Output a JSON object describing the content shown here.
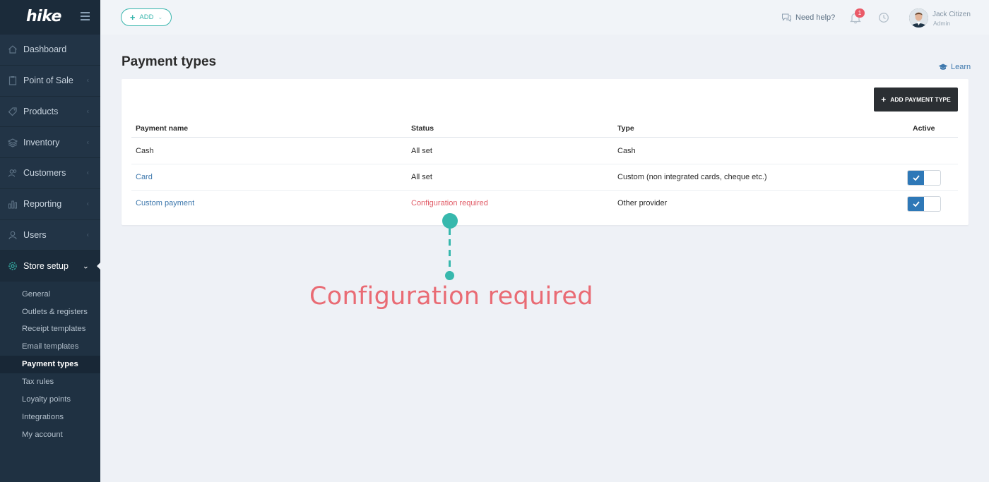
{
  "app": {
    "logo_text": "hike",
    "add_button_label": "ADD"
  },
  "header": {
    "help_label": "Need help?",
    "notification_count": "1",
    "user_name": "Jack Citizen",
    "user_role": "Admin"
  },
  "sidebar": {
    "items": [
      {
        "label": "Dashboard",
        "icon": "home-icon"
      },
      {
        "label": "Point of Sale",
        "icon": "clipboard-icon"
      },
      {
        "label": "Products",
        "icon": "tag-icon"
      },
      {
        "label": "Inventory",
        "icon": "layers-icon"
      },
      {
        "label": "Customers",
        "icon": "users-icon"
      },
      {
        "label": "Reporting",
        "icon": "bar-chart-icon"
      },
      {
        "label": "Users",
        "icon": "user-icon"
      },
      {
        "label": "Store setup",
        "icon": "gear-icon"
      }
    ],
    "sub_items": [
      "General",
      "Outlets & registers",
      "Receipt templates",
      "Email templates",
      "Payment types",
      "Tax rules",
      "Loyalty points",
      "Integrations",
      "My account"
    ],
    "active_sub_item": "Payment types"
  },
  "main": {
    "title": "Payment types",
    "learn_label": "Learn",
    "add_payment_type_label": "ADD PAYMENT TYPE",
    "columns": [
      "Payment name",
      "Status",
      "Type",
      "Active"
    ],
    "rows": [
      {
        "name": "Cash",
        "status": "All set",
        "type": "Cash",
        "active": null
      },
      {
        "name": "Card",
        "status": "All set",
        "type": "Custom (non integrated cards, cheque etc.)",
        "active": true
      },
      {
        "name": "Custom payment",
        "status": "Configuration required",
        "type": "Other provider",
        "active": true
      }
    ]
  },
  "annotation": {
    "text": "Configuration required"
  },
  "colors": {
    "sidebar_bg": "#1f3142",
    "accent_teal": "#37b8ad",
    "link_blue": "#3e78ad",
    "error_red": "#e15c67",
    "toggle_blue": "#2e78b7"
  }
}
